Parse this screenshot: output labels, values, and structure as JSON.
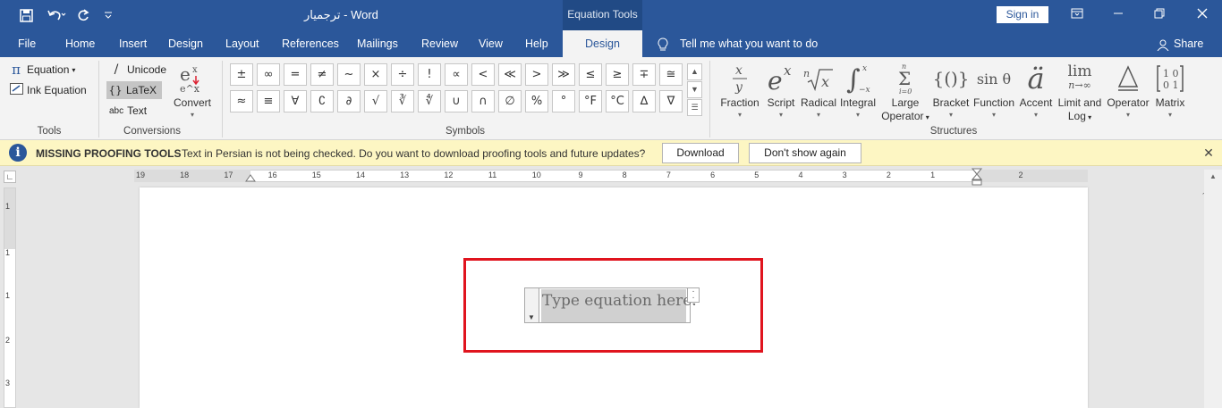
{
  "titlebar": {
    "doc_title": "ترجمیار  -  Word",
    "context_tab": "Equation Tools",
    "sign_in": "Sign in",
    "icons": [
      "save-icon",
      "undo-icon",
      "redo-icon",
      "customize-qat-icon",
      "ribbon-display-icon",
      "minimize-icon",
      "restore-icon",
      "close-icon"
    ]
  },
  "tabs": {
    "file": "File",
    "home": "Home",
    "insert": "Insert",
    "design": "Design",
    "layout": "Layout",
    "references": "References",
    "mailings": "Mailings",
    "review": "Review",
    "view": "View",
    "help": "Help",
    "eq_design": "Design",
    "tell_me": "Tell me what you want to do",
    "share": "Share"
  },
  "ribbon": {
    "tools": {
      "label": "Tools",
      "equation": "Equation",
      "ink_equation": "Ink Equation"
    },
    "conversions": {
      "label": "Conversions",
      "unicode": "Unicode",
      "latex": "LaTeX",
      "text": "Text",
      "abc": "abc",
      "convert": "Convert"
    },
    "symbols": {
      "label": "Symbols",
      "row1": [
        "±",
        "∞",
        "=",
        "≠",
        "~",
        "×",
        "÷",
        "!",
        "∝",
        "<",
        "≪",
        ">",
        "≫",
        "≤",
        "≥",
        "∓",
        "≅"
      ],
      "row2": [
        "≈",
        "≡",
        "∀",
        "∁",
        "∂",
        "√",
        "∛",
        "∜",
        "∪",
        "∩",
        "∅",
        "%",
        "°",
        "°F",
        "°C",
        "∆",
        "∇"
      ]
    },
    "structures": {
      "label": "Structures",
      "fraction": "Fraction",
      "script": "Script",
      "radical": "Radical",
      "integral": "Integral",
      "large_operator": "Large",
      "large_operator_2": "Operator",
      "bracket": "Bracket",
      "function": "Function",
      "accent": "Accent",
      "limit_log": "Limit and",
      "limit_log_2": "Log",
      "operator": "Operator",
      "matrix": "Matrix",
      "function_glyph": "sin θ",
      "limit_glyph": "lim",
      "limit_sub": "n→∞"
    }
  },
  "infobar": {
    "title": "MISSING PROOFING TOOLS",
    "message": "Text in Persian is not being checked. Do you want to download proofing tools and future updates?",
    "download": "Download",
    "dont_show": "Don't show again"
  },
  "ruler": {
    "numbers": [
      "19",
      "18",
      "17",
      "16",
      "15",
      "14",
      "13",
      "12",
      "11",
      "10",
      "9",
      "8",
      "7",
      "6",
      "5",
      "4",
      "3",
      "2",
      "1",
      "1",
      "2"
    ],
    "vertical_numbers": [
      "1",
      "1",
      "1",
      "2",
      "3"
    ]
  },
  "document": {
    "equation_placeholder": "Type equation here."
  }
}
